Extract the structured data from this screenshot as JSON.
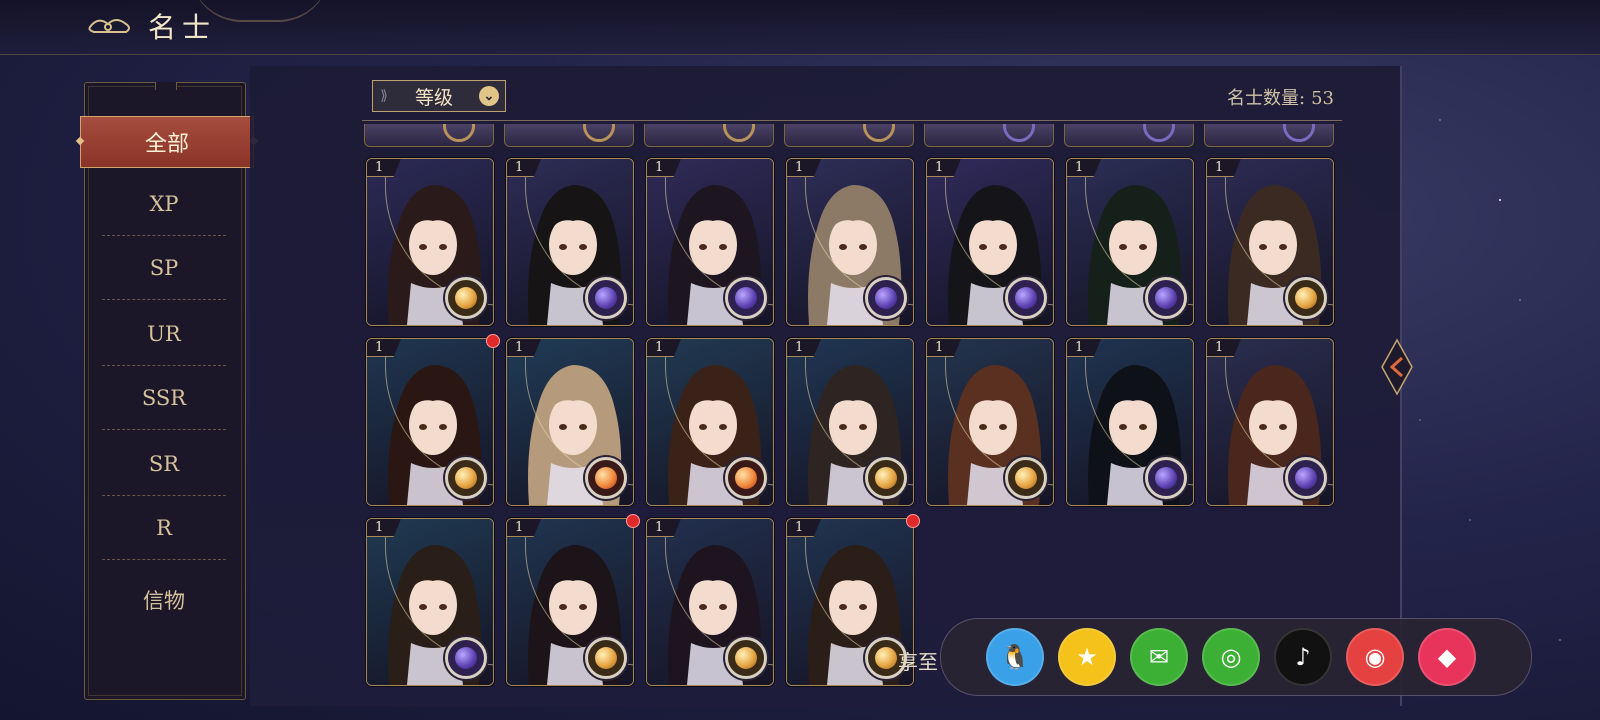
{
  "header": {
    "title": "名士"
  },
  "sidebar": {
    "items": [
      {
        "label": "全部",
        "active": true
      },
      {
        "label": "XP"
      },
      {
        "label": "SP"
      },
      {
        "label": "UR"
      },
      {
        "label": "SSR"
      },
      {
        "label": "SR"
      },
      {
        "label": "R"
      },
      {
        "label": "信物"
      }
    ]
  },
  "toolbar": {
    "sort_label": "等级",
    "count_label": "名士数量:",
    "count_value": "53"
  },
  "cards": [
    {
      "level": "1",
      "rarity": "gold"
    },
    {
      "level": "1",
      "rarity": "purple"
    },
    {
      "level": "1",
      "rarity": "purple"
    },
    {
      "level": "1",
      "rarity": "purple"
    },
    {
      "level": "1",
      "rarity": "purple"
    },
    {
      "level": "1",
      "rarity": "purple"
    },
    {
      "level": "1",
      "rarity": "gold"
    },
    {
      "level": "1",
      "rarity": "gold",
      "new": true
    },
    {
      "level": "1",
      "rarity": "red"
    },
    {
      "level": "1",
      "rarity": "red"
    },
    {
      "level": "1",
      "rarity": "gold"
    },
    {
      "level": "1",
      "rarity": "gold"
    },
    {
      "level": "1",
      "rarity": "purple"
    },
    {
      "level": "1",
      "rarity": "purple"
    },
    {
      "level": "1",
      "rarity": "purple"
    },
    {
      "level": "1",
      "rarity": "gold",
      "new": true
    },
    {
      "level": "1",
      "rarity": "gold"
    },
    {
      "level": "1",
      "rarity": "gold",
      "new": true
    }
  ],
  "share": {
    "label": "享至",
    "icons": [
      {
        "name": "qq-icon",
        "color": "#3aa0e8"
      },
      {
        "name": "qzone-icon",
        "color": "#f4c21a"
      },
      {
        "name": "wechat-icon",
        "color": "#3cb034"
      },
      {
        "name": "moments-icon",
        "color": "#3cb034"
      },
      {
        "name": "douyin-icon",
        "color": "#111111"
      },
      {
        "name": "weibo-icon",
        "color": "#e64141"
      },
      {
        "name": "gem-icon",
        "color": "#e8345a"
      }
    ]
  }
}
